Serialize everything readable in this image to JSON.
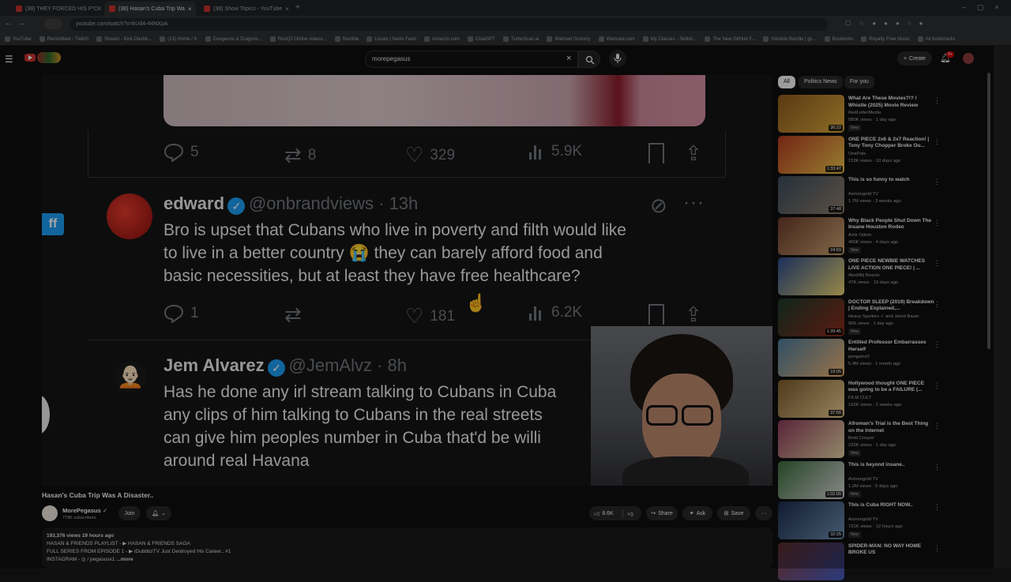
{
  "browser": {
    "tabs": [
      {
        "label": "(38) THEY FORCED HIS F*CK"
      },
      {
        "label": "(38) Hasan's Cuba Trip Wa"
      },
      {
        "label": "(38) Show Topics - YouTube"
      }
    ],
    "url": "youtube.com/watch?v=kUd4-44NXpA",
    "bookmarks": [
      "YouTube",
      "RemixMeet - Twitch",
      "Stream - Kick Dashb...",
      "(13) Home / X",
      "Dungeons & Dragons...",
      "ResQ3 Online videos...",
      "Rumble",
      "Locals | News Feed",
      "Amazon.com",
      "ChatGPT",
      "TurboScan.ai",
      "Walmart Grocery",
      "Webcast.com",
      "My Classes - Skillsh...",
      "The New GitHub F...",
      "Humble Bundle | gs...",
      "Bookmrks",
      "Royalty Free Music",
      "All bookmarks"
    ]
  },
  "header": {
    "search_value": "morepegasus",
    "create_label": "Create",
    "notification_count": "9+"
  },
  "video": {
    "tweet_top": {
      "replies": "5",
      "retweets": "8",
      "likes": "329",
      "views": "5.9K"
    },
    "tweet_mid": {
      "name": "edward",
      "handle": "@onbrandviews · 13h",
      "line1": "Bro is upset that Cubans who live in poverty and filth would like",
      "line2": "to live in a better country 😭 they can barely afford food and",
      "line3": "basic necessities, but at least they have free healthcare?",
      "replies": "1",
      "likes": "181",
      "views": "6.2K"
    },
    "tweet_bot": {
      "name": "Jem Alvarez",
      "handle": "@JemAlvz · 8h",
      "line1": "Has he done any irl stream talking to Cubans in Cuba",
      "line2": "any clips of him talking to Cubans in the real streets",
      "line3": "can give him peoples number in Cuba that'd be willi",
      "line4": "around real Havana"
    },
    "side_badge": "ff"
  },
  "meta": {
    "title": "Hasan's Cuba Trip Was A Disaster..",
    "channel": "MorePegasus",
    "subscribers": "779K subscribers",
    "join_label": "Join",
    "likes": "8.6K",
    "share_label": "Share",
    "ask_label": "Ask",
    "save_label": "Save"
  },
  "description": {
    "stats": "193,376 views  19 hours ago",
    "line1": "HASAN & FRIENDS PLAYLIST - ▶ HASAN & FRIENDS SAGA",
    "line2": "FULL SERIES FROM EPISODE 1 - ▶ iDubbbzTV Just Destroyed His Career.. #1",
    "line3": "INSTAGRAM - ◎ / pegasusx1",
    "more": "...more"
  },
  "sidebar": {
    "chips": [
      "All",
      "Politics News",
      "For you"
    ],
    "items": [
      {
        "title": "What Are These Movies?!? / Whistle (2025) Movie Review",
        "channel": "RedLetterMedia",
        "views": "580K views · 1 day ago",
        "new": "New",
        "dur": "36:22",
        "c1": "#8a5a1e",
        "c2": "#d8a53a"
      },
      {
        "title": "ONE PIECE 2x6 & 2x7 Reaction! | Tony Tony Chopper Broke Ou...",
        "channel": "OnePals",
        "views": "153K views · 10 days ago",
        "new": "",
        "dur": "1:33:47",
        "c1": "#b03a1e",
        "c2": "#e8c14a"
      },
      {
        "title": "This is so funny to watch",
        "channel": "Asmongold TV",
        "views": "1.7M views · 3 weeks ago",
        "new": "",
        "dur": "37:48",
        "c1": "#3a4a5a",
        "c2": "#8a7a6a"
      },
      {
        "title": "Why Black People Shut Down The Insane Houston Rodeo",
        "channel": "Amir Odom",
        "views": "490K views · 4 days ago",
        "new": "New",
        "dur": "24:59",
        "c1": "#6a3a2a",
        "c2": "#c8a070"
      },
      {
        "title": "ONE PIECE NEWBIE WATCHES LIVE ACTION ONE PIECE! | ...",
        "channel": "AlsoMilj Reacts",
        "views": "47K views · 13 days ago",
        "new": "",
        "dur": "",
        "c1": "#2a4a8a",
        "c2": "#e8d070"
      },
      {
        "title": "DOCTOR SLEEP (2019) Breakdown | Ending Explained,...",
        "channel": "Heavy Spoilers ✓ and Jared Bauer",
        "views": "96K views · 1 day ago",
        "new": "New",
        "dur": "1:39:45",
        "c1": "#1a3a2a",
        "c2": "#8a2a1a"
      },
      {
        "title": "Entitled Professor Embarrasses Herself",
        "channel": "penguinz0",
        "views": "5.4M views · 1 month ago",
        "new": "",
        "dur": "19:05",
        "c1": "#4a7a9a",
        "c2": "#e8b070"
      },
      {
        "title": "Hollywood thought ONE PIECE was going to be a FAILURE (...",
        "channel": "FILM CULT",
        "views": "162K views · 2 weeks ago",
        "new": "",
        "dur": "37:56",
        "c1": "#7a5a2a",
        "c2": "#e8c890"
      },
      {
        "title": "Afroman's Trial is the Best Thing on the Internet",
        "channel": "Brett Cooper",
        "views": "232K views · 1 day ago",
        "new": "New",
        "dur": "",
        "c1": "#8a3a5a",
        "c2": "#e0d0a0"
      },
      {
        "title": "This is beyond insane..",
        "channel": "Asmongold TV",
        "views": "1.2M views · 5 days ago",
        "new": "New",
        "dur": "1:02:00",
        "c1": "#3a6a3a",
        "c2": "#d0d0d0"
      },
      {
        "title": "This is Cuba RIGHT NOW..",
        "channel": "Asmongold TV",
        "views": "731K views · 12 hours ago",
        "new": "New",
        "dur": "32:25",
        "c1": "#1a2a4a",
        "c2": "#6a8aaa"
      },
      {
        "title": "SPIDER-MAN: NO WAY HOME BROKE US",
        "channel": "",
        "views": "",
        "new": "",
        "dur": "",
        "c1": "#5a2a2a",
        "c2": "#2a3a7a"
      }
    ]
  }
}
